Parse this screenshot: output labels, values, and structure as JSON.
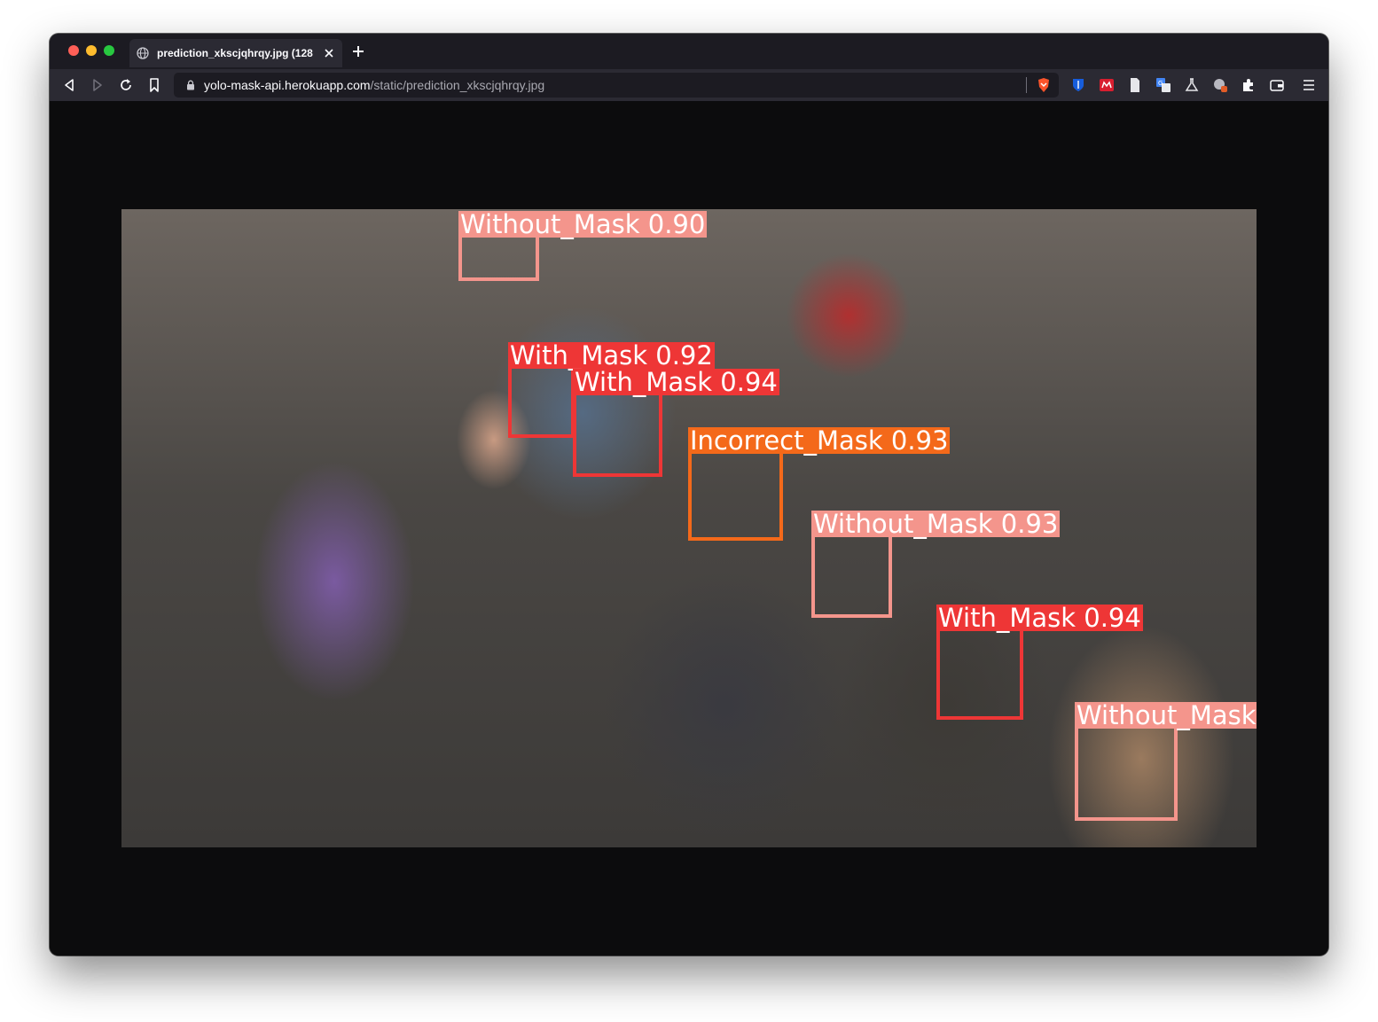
{
  "browser": {
    "tab_title": "prediction_xkscjqhrqy.jpg (128",
    "url_host": "yolo-mask-api.herokuapp.com",
    "url_path": "/static/prediction_xkscjqhrqy.jpg"
  },
  "colors": {
    "without_mask": "#f4958c",
    "with_mask": "#ee3636",
    "incorrect_mask": "#f4691a"
  },
  "detections": [
    {
      "label": "Without_Mask 0.90",
      "class": "without_mask"
    },
    {
      "label": "With_Mask 0.92",
      "class": "with_mask"
    },
    {
      "label": "With_Mask 0.94",
      "class": "with_mask"
    },
    {
      "label": "Incorrect_Mask 0.93",
      "class": "incorrect_mask"
    },
    {
      "label": "Without_Mask 0.93",
      "class": "without_mask"
    },
    {
      "label": "With_Mask 0.94",
      "class": "with_mask"
    },
    {
      "label": "Without_Mask",
      "class": "without_mask"
    }
  ]
}
